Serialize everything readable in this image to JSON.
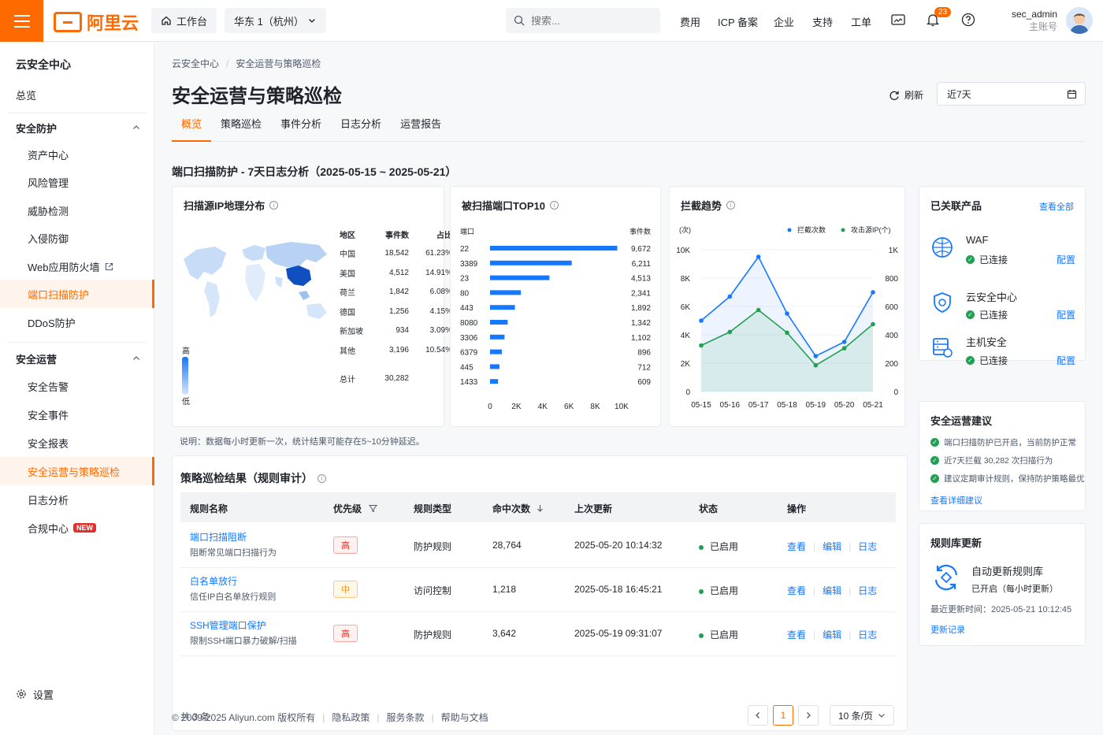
{
  "topbar": {
    "logo_text": "阿里云",
    "workbench": "工作台",
    "region": "华东 1（杭州）",
    "search_placeholder": "搜索...",
    "nav": [
      "费用",
      "ICP 备案",
      "企业",
      "支持",
      "工单"
    ],
    "notification_count": "23",
    "user_name": "sec_admin",
    "user_role": "主账号"
  },
  "sidebar": {
    "title": "云安全中心",
    "overview": "总览",
    "group1": "安全防护",
    "group1_items": [
      "资产中心",
      "风险管理",
      "威胁检测",
      "入侵防御",
      "Web应用防火墙",
      "端口扫描防护",
      "DDoS防护"
    ],
    "group2": "安全运营",
    "group2_items": [
      "安全告警",
      "安全事件",
      "安全报表",
      "安全运营与策略巡检",
      "日志分析",
      "合规中心"
    ],
    "new_tag": "NEW",
    "settings": "设置"
  },
  "page": {
    "breadcrumb": [
      "云安全中心",
      "安全运营与策略巡检"
    ],
    "title": "安全运营与策略巡检",
    "refresh": "刷新",
    "date_range": "近7天",
    "tabs": [
      "概览",
      "策略巡检",
      "事件分析",
      "日志分析",
      "运营报告"
    ],
    "section_title": "端口扫描防护 - 7天日志分析（2025-05-15 ~ 2025-05-21）",
    "note": "说明：数据每小时更新一次，统计结果可能存在5~10分钟延迟。"
  },
  "geo": {
    "title": "扫描源IP地理分布",
    "headers": [
      "地区",
      "事件数",
      "占比"
    ],
    "rows": [
      [
        "中国",
        "18,542",
        "61.23%"
      ],
      [
        "美国",
        "4,512",
        "14.91%"
      ],
      [
        "荷兰",
        "1,842",
        "6.08%"
      ],
      [
        "德国",
        "1,256",
        "4.15%"
      ],
      [
        "新加坡",
        "934",
        "3.09%"
      ],
      [
        "其他",
        "3,196",
        "10.54%"
      ]
    ],
    "total_label": "总计",
    "total": "30,282",
    "legend_high": "高",
    "legend_low": "低"
  },
  "chart_data": [
    {
      "type": "bar",
      "title": "被扫描端口TOP10",
      "xlabel": "",
      "ylabel": "端口",
      "value_header": "事件数",
      "categories": [
        "22",
        "3389",
        "23",
        "80",
        "443",
        "8080",
        "3306",
        "6379",
        "445",
        "1433"
      ],
      "values": [
        9672,
        6211,
        4513,
        2341,
        1892,
        1342,
        1102,
        896,
        712,
        609
      ],
      "value_labels": [
        "9,672",
        "6,211",
        "4,513",
        "2,341",
        "1,892",
        "1,342",
        "1,102",
        "896",
        "712",
        "609"
      ],
      "xlim": [
        0,
        10000
      ],
      "xticks": [
        "0",
        "2K",
        "4K",
        "6K",
        "8K",
        "10K"
      ],
      "color": "#1677ff"
    },
    {
      "type": "line",
      "title": "拦截趋势",
      "left_unit": "(次)",
      "categories": [
        "05-15",
        "05-16",
        "05-17",
        "05-18",
        "05-19",
        "05-20",
        "05-21"
      ],
      "series": [
        {
          "name": "拦截次数",
          "axis": "left",
          "color": "#1677ff",
          "values": [
            5000,
            6700,
            9500,
            5500,
            2500,
            3500,
            7000
          ]
        },
        {
          "name": "攻击源IP(个)",
          "axis": "right",
          "color": "#22a052",
          "values": [
            325,
            420,
            575,
            415,
            185,
            305,
            475
          ]
        }
      ],
      "left_ticks": [
        "0",
        "2K",
        "4K",
        "6K",
        "8K",
        "10K"
      ],
      "right_ticks": [
        "0",
        "200",
        "400",
        "600",
        "800",
        "1K"
      ],
      "ylim_left": [
        0,
        10000
      ],
      "ylim_right": [
        0,
        1000
      ],
      "legend": "top-right"
    }
  ],
  "products": {
    "title": "已关联产品",
    "view_all": "查看全部",
    "items": [
      {
        "name": "WAF",
        "status": "已连接",
        "action": "配置"
      },
      {
        "name": "云安全中心",
        "status": "已连接",
        "action": "配置"
      },
      {
        "name": "主机安全",
        "status": "已连接",
        "action": "配置"
      }
    ]
  },
  "suggestions": {
    "title": "安全运营建议",
    "items": [
      "端口扫描防护已开启，当前防护正常",
      "近7天拦截 30,282 次扫描行为",
      "建议定期审计规则，保持防护策略最优"
    ],
    "link": "查看详细建议"
  },
  "rules_update": {
    "title": "规则库更新",
    "name": "自动更新规则库",
    "status": "已开启（每小时更新）",
    "last_update": "最近更新时间：2025-05-21 10:12:45",
    "link": "更新记录"
  },
  "policy": {
    "title": "策略巡检结果（规则审计）",
    "headers": [
      "规则名称",
      "优先级",
      "规则类型",
      "命中次数",
      "上次更新",
      "状态",
      "操作"
    ],
    "rows": [
      {
        "name": "端口扫描阻断",
        "desc": "阻断常见端口扫描行为",
        "priority": "高",
        "type": "防护规则",
        "hits": "28,764",
        "updated": "2025-05-20 10:14:32",
        "status": "已启用"
      },
      {
        "name": "白名单放行",
        "desc": "信任IP白名单放行规则",
        "priority": "中",
        "type": "访问控制",
        "hits": "1,218",
        "updated": "2025-05-18 16:45:21",
        "status": "已启用"
      },
      {
        "name": "SSH管理端口保护",
        "desc": "限制SSH端口暴力破解/扫描",
        "priority": "高",
        "type": "防护规则",
        "hits": "3,642",
        "updated": "2025-05-19 09:31:07",
        "status": "已启用"
      }
    ],
    "ops": [
      "查看",
      "编辑",
      "日志"
    ],
    "total": "共 3 条",
    "page": "1",
    "page_size": "10 条/页"
  },
  "footer": {
    "copyright": "© 2009-2025 Aliyun.com 版权所有",
    "links": [
      "隐私政策",
      "服务条款",
      "帮助与文档"
    ]
  }
}
